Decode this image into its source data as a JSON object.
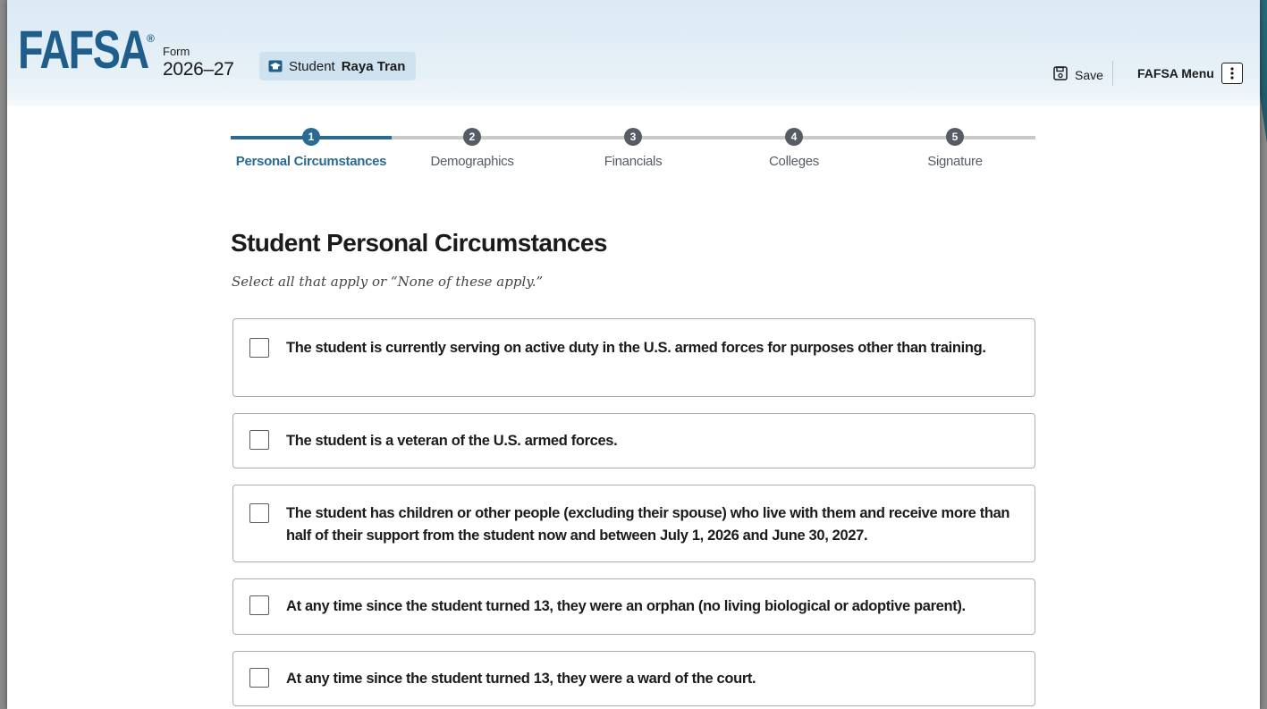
{
  "header": {
    "logo": "FAFSA",
    "registered_mark": "®",
    "form_label": "Form",
    "form_year": "2026–27",
    "student_role": "Student",
    "student_name": "Raya Tran",
    "save_label": "Save",
    "menu_label": "FAFSA Menu"
  },
  "steps": [
    {
      "number": "1",
      "label": "Personal Circumstances",
      "active": true
    },
    {
      "number": "2",
      "label": "Demographics",
      "active": false
    },
    {
      "number": "3",
      "label": "Financials",
      "active": false
    },
    {
      "number": "4",
      "label": "Colleges",
      "active": false
    },
    {
      "number": "5",
      "label": "Signature",
      "active": false
    }
  ],
  "main": {
    "title": "Student Personal Circumstances",
    "subtitle": "Select all that apply or “None of these apply.”",
    "options": [
      {
        "text": "The student is currently serving on active duty in the U.S. armed forces for purposes other than training.",
        "checked": false
      },
      {
        "text": "The student is a veteran of the U.S. armed forces.",
        "checked": false
      },
      {
        "text": "The student has children or other people (excluding their spouse) who live with them and receive more than half of their support from the student now and between July 1, 2026 and June 30, 2027.",
        "checked": false
      },
      {
        "text": "At any time since the student turned 13, they were an orphan (no living biological or adoptive parent).",
        "checked": false
      },
      {
        "text": "At any time since the student turned 13, they were a ward of the court.",
        "checked": false
      }
    ]
  },
  "colors": {
    "brand": "#1f5d8a",
    "active_step": "#2a6b93",
    "inactive_step": "#565c65",
    "header_bg": "#dbeaf4"
  }
}
